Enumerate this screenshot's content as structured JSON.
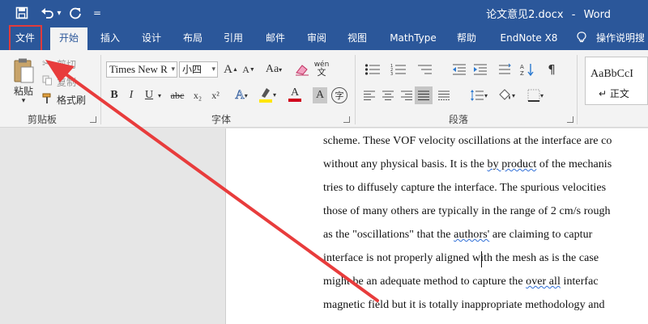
{
  "window": {
    "doc_name": "论文意见2.docx",
    "separator": "-",
    "app_name": "Word"
  },
  "quick_access": {
    "save_icon": "save-icon",
    "undo_icon": "undo-icon",
    "undo_dropdown": "▾",
    "redo_icon": "redo-icon",
    "customize": "="
  },
  "tabs": [
    {
      "label": "文件"
    },
    {
      "label": "开始"
    },
    {
      "label": "插入"
    },
    {
      "label": "设计"
    },
    {
      "label": "布局"
    },
    {
      "label": "引用"
    },
    {
      "label": "邮件"
    },
    {
      "label": "审阅"
    },
    {
      "label": "视图"
    },
    {
      "label": "MathType"
    },
    {
      "label": "帮助"
    },
    {
      "label": "EndNote X8"
    },
    {
      "label": "操作说明搜"
    }
  ],
  "clipboard": {
    "paste": "粘贴",
    "cut": "剪切",
    "copy": "复制",
    "format_painter": "格式刷",
    "group": "剪贴板"
  },
  "font": {
    "family": "Times New R",
    "size": "小四",
    "group": "字体",
    "grow": "A",
    "shrink": "A",
    "change_case": "Aa",
    "phonetic": "wén",
    "bold": "B",
    "italic": "I",
    "underline": "U",
    "strike": "abc",
    "subscript": "x₂",
    "superscript": "x²",
    "text_effects": "A",
    "font_color": "A",
    "char_shading": "A",
    "enclose": "字"
  },
  "paragraph": {
    "group": "段落"
  },
  "styles": {
    "sample": "AaBbCcI",
    "name": "↵ 正文"
  },
  "document": {
    "lines": [
      {
        "parts": [
          {
            "t": "scheme. These VOF velocity oscillations at the interface are co",
            "s": false
          }
        ]
      },
      {
        "parts": [
          {
            "t": "without any physical basis. It is the ",
            "s": false
          },
          {
            "t": "by product",
            "s": true
          },
          {
            "t": " of the mechanis",
            "s": false
          }
        ]
      },
      {
        "parts": [
          {
            "t": "tries to diffusely capture the interface. The spurious velocities",
            "s": false
          }
        ]
      },
      {
        "parts": [
          {
            "t": "those of many others are typically in the range of 2 cm/s rough",
            "s": false
          }
        ]
      },
      {
        "parts": [
          {
            "t": "as the \"oscillations\" that the ",
            "s": false
          },
          {
            "t": "authors'",
            "s": true
          },
          {
            "t": " are claiming to captur",
            "s": false
          }
        ]
      },
      {
        "parts": [
          {
            "t": "interface is not properly aligned with the mesh as is the case",
            "s": false
          }
        ]
      },
      {
        "parts": [
          {
            "t": "might be an adequate method to capture the ",
            "s": false
          },
          {
            "t": "over all",
            "s": true
          },
          {
            "t": " interfac",
            "s": false
          }
        ]
      },
      {
        "parts": [
          {
            "t": "magnetic field but it is totally inappropriate methodology and",
            "s": false
          }
        ]
      }
    ]
  },
  "colors": {
    "title_blue": "#2b579a",
    "highlight_red": "#e23b3b",
    "ribbon_bg": "#f3f3f3",
    "highlighter_yellow": "#ffe600",
    "font_red": "#d0021b"
  }
}
